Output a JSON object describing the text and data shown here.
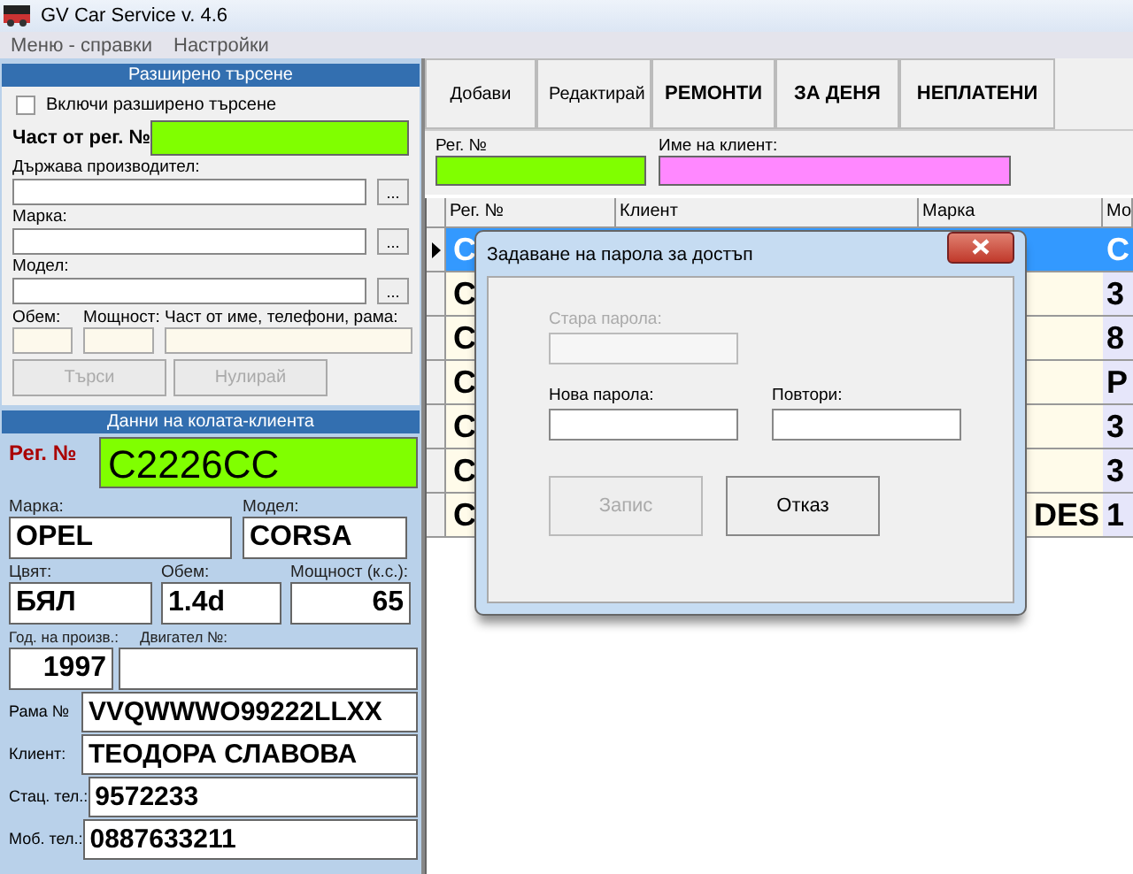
{
  "window": {
    "title": "GV Car Service v. 4.6"
  },
  "menu": [
    "Меню - справки",
    "Настройки"
  ],
  "search_panel": {
    "title": "Разширено търсене",
    "toggle": {
      "label": "Включи разширено търсене",
      "checked": false
    },
    "reg_label": "Част от рег. №",
    "pick_fields": [
      {
        "label": "Държава производител:",
        "button": "..."
      },
      {
        "label": "Марка:",
        "button": "..."
      },
      {
        "label": "Модел:",
        "button": "..."
      }
    ],
    "small_fields": [
      "Обем:",
      "Мощност:",
      "Част от име, телефони, рама:"
    ],
    "buttons": [
      {
        "label": "Търси",
        "disabled": true
      },
      {
        "label": "Нулирай",
        "disabled": true
      }
    ]
  },
  "car_panel": {
    "title": "Данни на колата-клиента",
    "reg_label": "Рег. №",
    "reg_value": "C2226CC",
    "grid_rows": [
      [
        {
          "label": "Марка:",
          "value": "OPEL"
        },
        {
          "label": "Модел:",
          "value": "CORSA"
        }
      ],
      [
        {
          "label": "Цвят:",
          "value": "БЯЛ"
        },
        {
          "label": "Обем:",
          "value": "1.4d"
        },
        {
          "label": "Мощност (к.с.):",
          "value": "65",
          "align_right": true
        }
      ],
      [
        {
          "label": "Год. на произв.:",
          "value": "1997",
          "align_right": true
        },
        {
          "label": "Двигател №:"
        }
      ]
    ],
    "side_fields": [
      {
        "label": "Рама №",
        "value": "VVQWWWO99222LLXX"
      },
      {
        "label": "Клиент:",
        "value": "ТЕОДОРА СЛАВОВА"
      },
      {
        "label": "Стац. тел.:",
        "value": "9572233"
      },
      {
        "label": "Моб. тел.:",
        "value": "0887633211"
      }
    ]
  },
  "toolbar": [
    {
      "label": "Добави",
      "kind": "plain"
    },
    {
      "label": "Редактирай",
      "kind": "plain"
    },
    {
      "label": "РЕМОНТИ",
      "kind": "bold"
    },
    {
      "label": "ЗА ДЕНЯ",
      "kind": "bold"
    },
    {
      "label": "НЕПЛАТЕНИ",
      "kind": "bold"
    }
  ],
  "filters": [
    {
      "label": "Рег. №",
      "color": "#80ff00"
    },
    {
      "label": "Име на клиент:",
      "color": "#ff88ff"
    }
  ],
  "table": {
    "columns": [
      "Рег. №",
      "Клиент",
      "Марка",
      "Мо"
    ],
    "rows": [
      {
        "reg": "C",
        "model": "C",
        "selected": true
      },
      {
        "reg": "C",
        "model": "3",
        "selected": false
      },
      {
        "reg": "C",
        "model": "8",
        "selected": false
      },
      {
        "reg": "C",
        "model": "P",
        "selected": false
      },
      {
        "reg": "C",
        "model": "3",
        "selected": false
      },
      {
        "reg": "C",
        "model": "3",
        "selected": false
      },
      {
        "reg": "C",
        "marka": "DES",
        "model": "1",
        "selected": false
      }
    ]
  },
  "dialog": {
    "title": "Задаване на парола за достъп",
    "fields": [
      {
        "label": "Стара парола:",
        "disabled": true
      },
      {
        "label": "Нова парола:",
        "disabled": false
      },
      {
        "label": "Повтори:",
        "disabled": false
      }
    ],
    "buttons": [
      {
        "label": "Запис",
        "disabled": true
      },
      {
        "label": "Отказ",
        "disabled": false
      }
    ]
  }
}
